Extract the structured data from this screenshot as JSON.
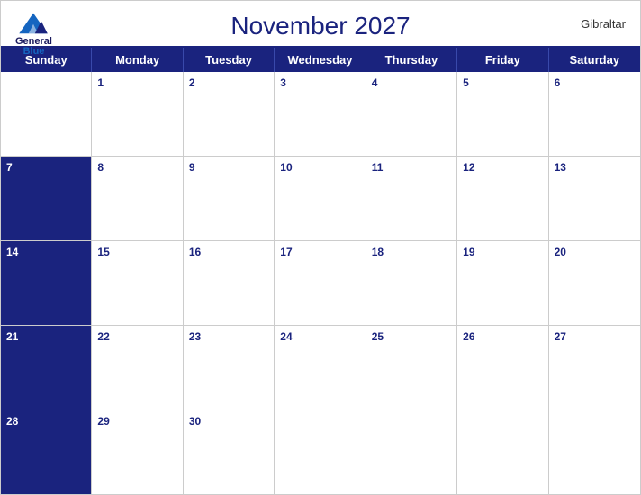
{
  "header": {
    "title": "November 2027",
    "region": "Gibraltar",
    "logo": {
      "line1": "General",
      "line2": "Blue"
    }
  },
  "dayHeaders": [
    "Sunday",
    "Monday",
    "Tuesday",
    "Wednesday",
    "Thursday",
    "Friday",
    "Saturday"
  ],
  "weeks": [
    [
      {
        "day": "",
        "blue": true
      },
      {
        "day": "1",
        "blue": false
      },
      {
        "day": "2",
        "blue": false
      },
      {
        "day": "3",
        "blue": false
      },
      {
        "day": "4",
        "blue": false
      },
      {
        "day": "5",
        "blue": false
      },
      {
        "day": "6",
        "blue": false
      }
    ],
    [
      {
        "day": "7",
        "blue": true
      },
      {
        "day": "8",
        "blue": false
      },
      {
        "day": "9",
        "blue": false
      },
      {
        "day": "10",
        "blue": false
      },
      {
        "day": "11",
        "blue": false
      },
      {
        "day": "12",
        "blue": false
      },
      {
        "day": "13",
        "blue": false
      }
    ],
    [
      {
        "day": "14",
        "blue": true
      },
      {
        "day": "15",
        "blue": false
      },
      {
        "day": "16",
        "blue": false
      },
      {
        "day": "17",
        "blue": false
      },
      {
        "day": "18",
        "blue": false
      },
      {
        "day": "19",
        "blue": false
      },
      {
        "day": "20",
        "blue": false
      }
    ],
    [
      {
        "day": "21",
        "blue": true
      },
      {
        "day": "22",
        "blue": false
      },
      {
        "day": "23",
        "blue": false
      },
      {
        "day": "24",
        "blue": false
      },
      {
        "day": "25",
        "blue": false
      },
      {
        "day": "26",
        "blue": false
      },
      {
        "day": "27",
        "blue": false
      }
    ],
    [
      {
        "day": "28",
        "blue": true
      },
      {
        "day": "29",
        "blue": false
      },
      {
        "day": "30",
        "blue": false
      },
      {
        "day": "",
        "blue": false
      },
      {
        "day": "",
        "blue": false
      },
      {
        "day": "",
        "blue": false
      },
      {
        "day": "",
        "blue": false
      }
    ]
  ]
}
